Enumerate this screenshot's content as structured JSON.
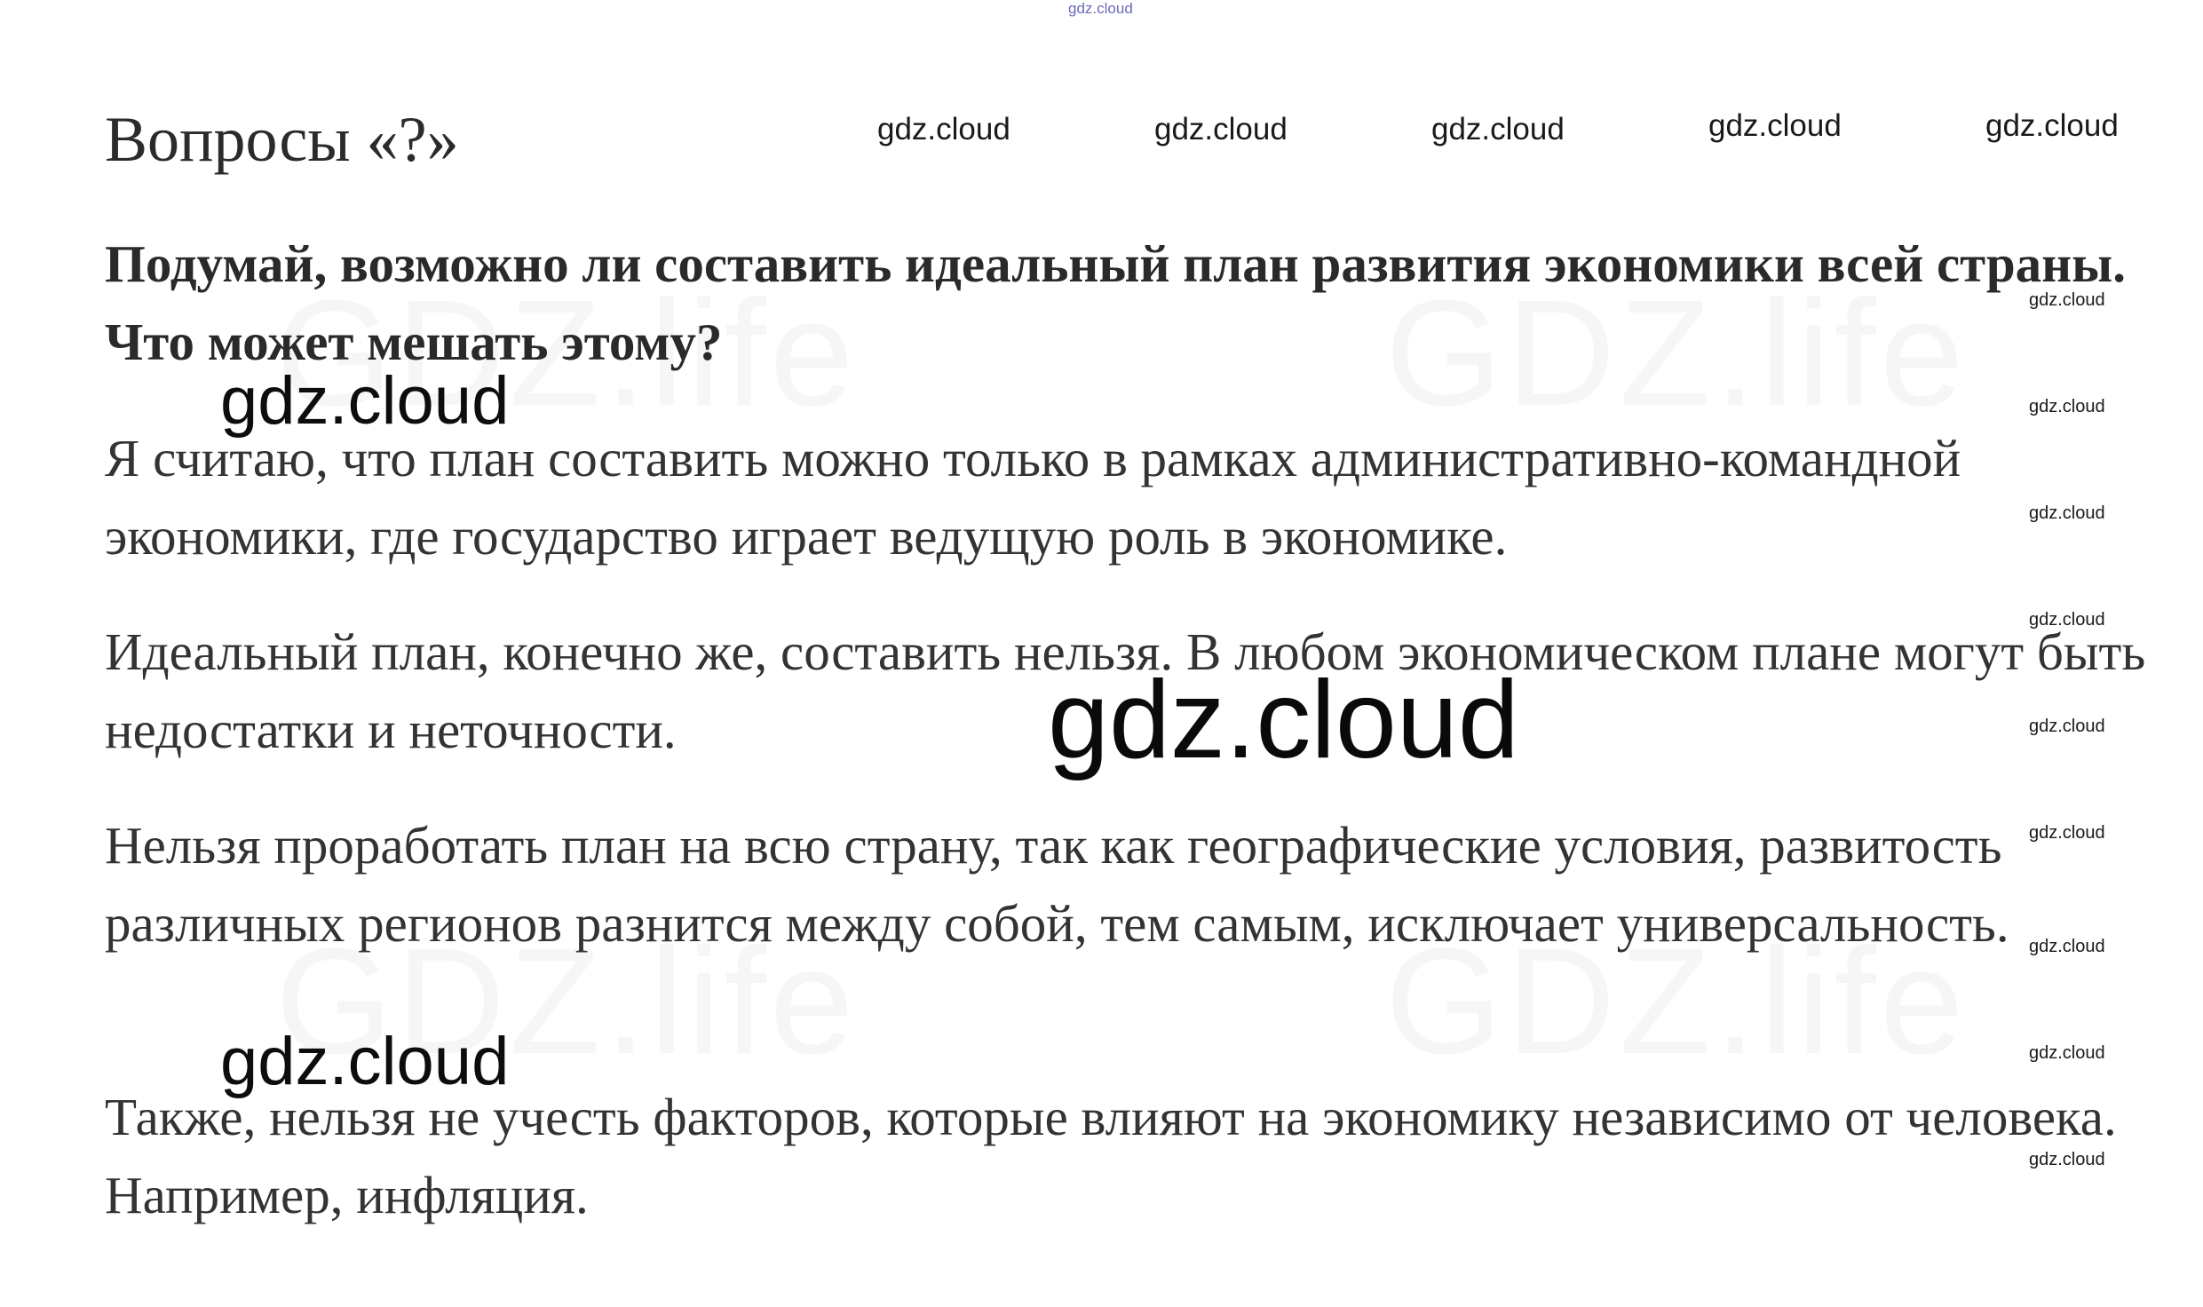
{
  "page": {
    "title": "Вопросы «?»",
    "question": "Подумай, возможно ли составить идеальный план развития экономики всей страны. Что может мешать этому?",
    "answers": [
      "Я считаю, что план составить можно только в рамках административно-командной экономики, где государство играет ведущую роль в экономике.",
      "Идеальный план, конечно же, составить нельзя. В любом экономическом плане могут быть недостатки и неточности.",
      "Нельзя проработать план на всю страну, так как географические условия, развитость различных регионов разнится между собой, тем самым, исключает универсальность.",
      "Также, нельзя не учесть факторов, которые влияют на экономику независимо от человека. Например, инфляция."
    ]
  },
  "watermarks": {
    "text": "gdz.cloud",
    "background_prefix": "GDZ",
    "background_suffix": ".life"
  }
}
